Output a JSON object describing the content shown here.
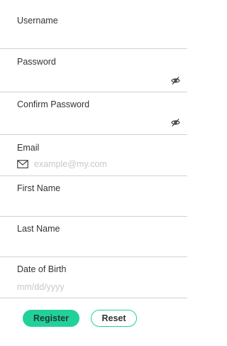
{
  "form": {
    "username": {
      "label": "Username",
      "value": ""
    },
    "password": {
      "label": "Password",
      "value": "",
      "toggle_icon": "eye-slash-icon"
    },
    "confirm_password": {
      "label": "Confirm Password",
      "value": "",
      "toggle_icon": "eye-slash-icon"
    },
    "email": {
      "label": "Email",
      "placeholder": "example@my.com",
      "icon": "envelope-icon"
    },
    "first_name": {
      "label": "First Name",
      "value": ""
    },
    "last_name": {
      "label": "Last Name",
      "value": ""
    },
    "date_of_birth": {
      "label": "Date of Birth",
      "placeholder": "mm/dd/yyyy"
    }
  },
  "actions": {
    "register_label": "Register",
    "reset_label": "Reset"
  },
  "colors": {
    "accent": "#22d19a",
    "divider": "#d2d2d2",
    "placeholder": "#c8c8c8",
    "label": "#333333"
  }
}
